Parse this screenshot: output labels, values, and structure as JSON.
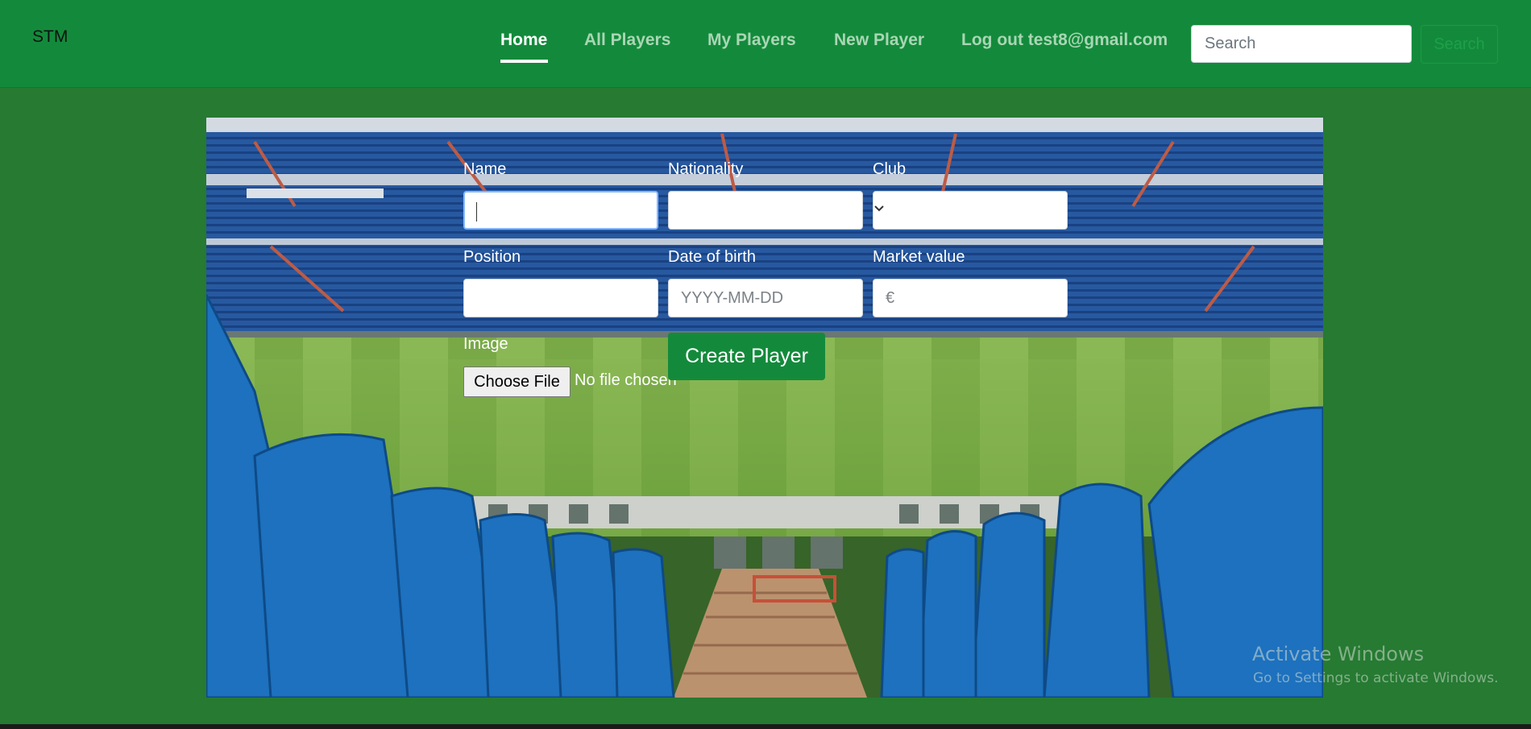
{
  "nav": {
    "brand": "STM",
    "links": [
      {
        "label": "Home",
        "active": true
      },
      {
        "label": "All Players",
        "active": false
      },
      {
        "label": "My Players",
        "active": false
      },
      {
        "label": "New Player",
        "active": false
      },
      {
        "label": "Log out test8@gmail.com",
        "active": false
      }
    ],
    "search_placeholder": "Search",
    "search_button": "Search"
  },
  "form": {
    "name_label": "Name",
    "nationality_label": "Nationality",
    "club_label": "Club",
    "position_label": "Position",
    "dob_label": "Date of birth",
    "dob_placeholder": "YYYY-MM-DD",
    "market_value_label": "Market value",
    "market_value_placeholder": "€",
    "image_label": "Image",
    "choose_file_label": "Choose File",
    "no_file_text": "No file chosen",
    "create_button": "Create Player"
  },
  "watermark": {
    "title": "Activate Windows",
    "subtitle": "Go to Settings to activate Windows."
  },
  "colors": {
    "navbar": "#138a3b",
    "page_background": "#267a32",
    "accent": "#138a3b"
  }
}
